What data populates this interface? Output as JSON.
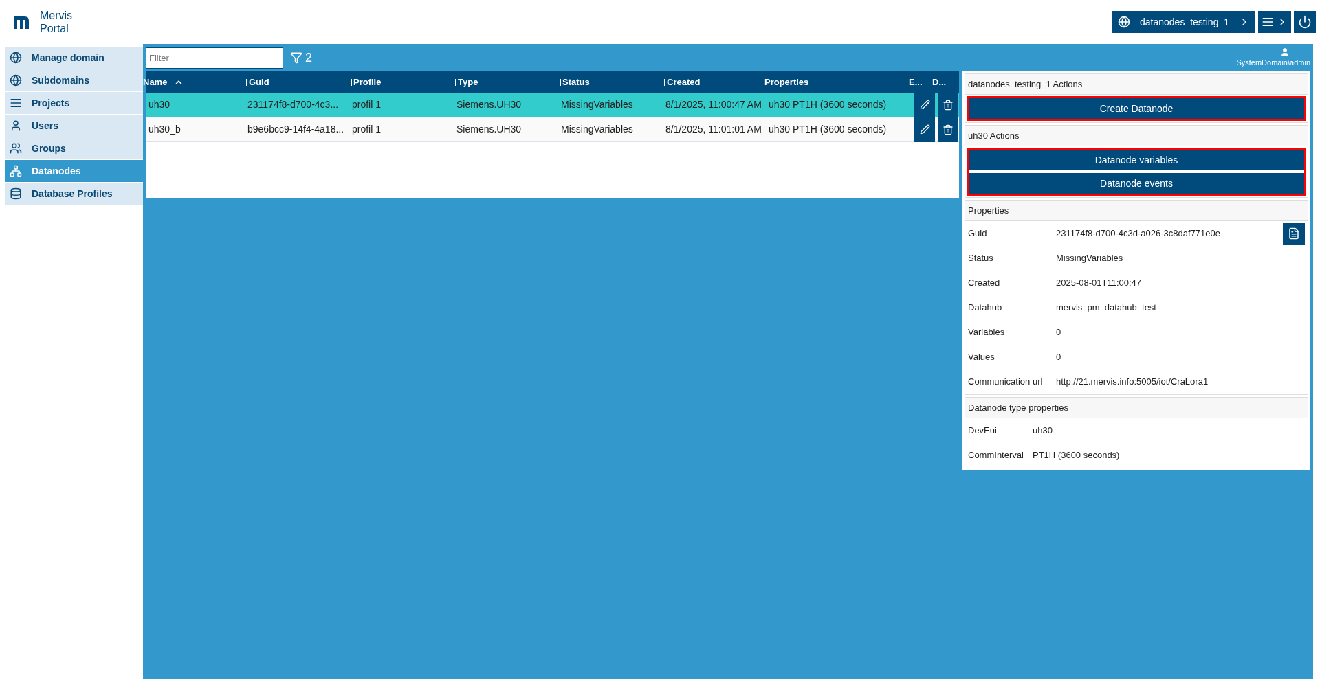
{
  "brand": {
    "line1": "Mervis",
    "line2": "Portal"
  },
  "topbar": {
    "domain": "datanodes_testing_1",
    "user": "SystemDomain\\admin"
  },
  "sidebar": {
    "items": [
      {
        "label": "Manage domain",
        "selected": false
      },
      {
        "label": "Subdomains",
        "selected": false
      },
      {
        "label": "Projects",
        "selected": false
      },
      {
        "label": "Users",
        "selected": false
      },
      {
        "label": "Groups",
        "selected": false
      },
      {
        "label": "Datanodes",
        "selected": true
      },
      {
        "label": "Database Profiles",
        "selected": false
      }
    ]
  },
  "filter": {
    "placeholder": "Filter",
    "count": "2"
  },
  "table": {
    "columns": [
      {
        "label": "Name",
        "sorted": true
      },
      {
        "label": "Guid",
        "sorted": false
      },
      {
        "label": "Profile",
        "sorted": false
      },
      {
        "label": "Type",
        "sorted": false
      },
      {
        "label": "Status",
        "sorted": false
      },
      {
        "label": "Created",
        "sorted": false
      },
      {
        "label": "Properties",
        "sorted": false
      },
      {
        "label": "E...",
        "sorted": false
      },
      {
        "label": "D...",
        "sorted": false
      }
    ],
    "rows": [
      {
        "selected": true,
        "cells": [
          "uh30",
          "231174f8-d700-4c3...",
          "profil 1",
          "Siemens.UH30",
          "MissingVariables",
          "8/1/2025, 11:00:47 AM",
          "uh30 PT1H (3600 seconds)"
        ]
      },
      {
        "selected": false,
        "cells": [
          "uh30_b",
          "b9e6bcc9-14f4-4a18...",
          "profil 1",
          "Siemens.UH30",
          "MissingVariables",
          "8/1/2025, 11:01:01 AM",
          "uh30 PT1H (3600 seconds)"
        ]
      }
    ]
  },
  "actions": [
    {
      "title": "datanodes_testing_1 Actions",
      "highlighted": true,
      "buttons": [
        "Create Datanode"
      ]
    },
    {
      "title": "uh30 Actions",
      "highlighted": true,
      "buttons": [
        "Datanode variables",
        "Datanode events"
      ]
    }
  ],
  "properties": {
    "title": "Properties",
    "rows": [
      {
        "label": "Guid",
        "value": "231174f8-d700-4c3d-a026-3c8daf771e0e",
        "copy": true
      },
      {
        "label": "Status",
        "value": "MissingVariables",
        "copy": false
      },
      {
        "label": "Created",
        "value": "2025-08-01T11:00:47",
        "copy": false
      },
      {
        "label": "Datahub",
        "value": "mervis_pm_datahub_test",
        "copy": false
      },
      {
        "label": "Variables",
        "value": "0",
        "copy": false
      },
      {
        "label": "Values",
        "value": "0",
        "copy": false
      },
      {
        "label": "Communication url",
        "value": "http://21.mervis.info:5005/iot/CraLora1",
        "copy": false
      }
    ]
  },
  "type_properties": {
    "title": "Datanode type properties",
    "rows": [
      {
        "label": "DevEui",
        "value": "uh30"
      },
      {
        "label": "CommInterval",
        "value": "PT1H (3600 seconds)"
      }
    ]
  }
}
